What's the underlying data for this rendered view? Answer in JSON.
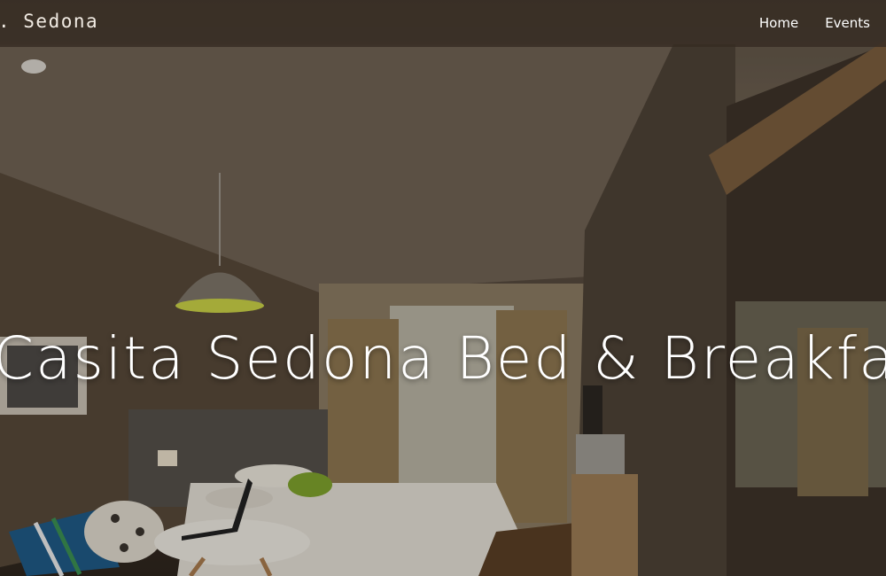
{
  "navbar": {
    "brand": ". Sedona",
    "links": [
      {
        "label": "Home"
      },
      {
        "label": "Events"
      }
    ]
  },
  "hero": {
    "title": "Casita Sedona Bed & Breakfast"
  },
  "colors": {
    "navbar_bg": "#342a21",
    "text": "#ffffff"
  }
}
